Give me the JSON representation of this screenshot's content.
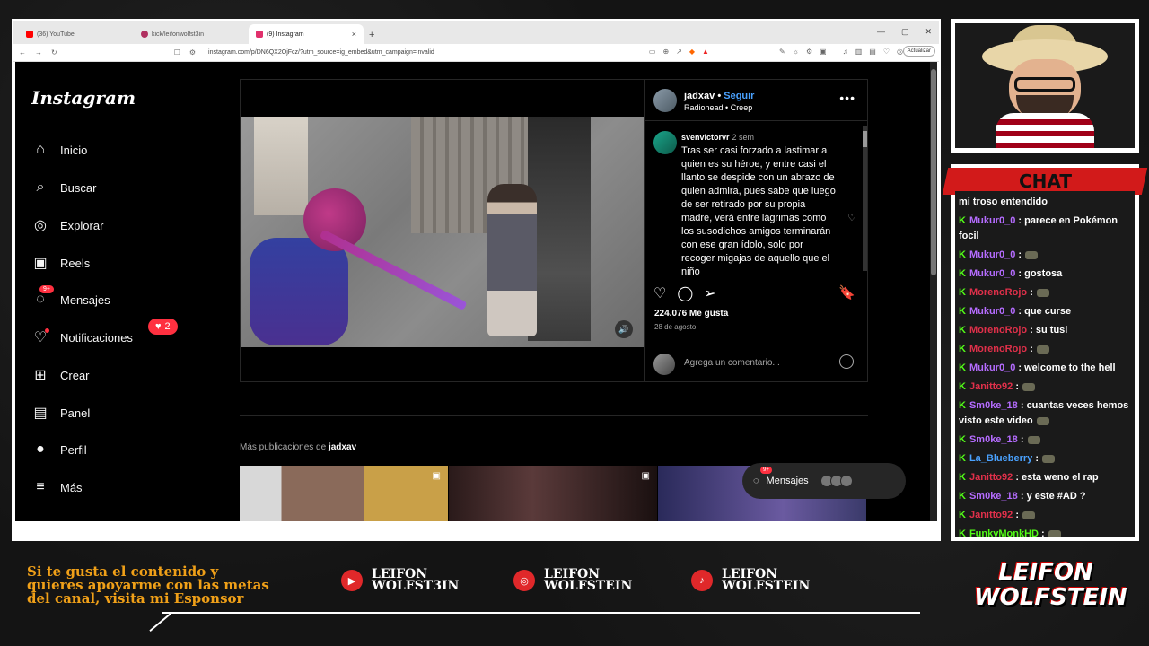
{
  "browser": {
    "tabs": [
      {
        "label": "(36) YouTube",
        "color": "#ff0000"
      },
      {
        "label": "kick/leifonwolfst3in",
        "color": "#b03060"
      },
      {
        "label": "(9) Instagram",
        "color": "#e1306c"
      }
    ],
    "new_tab": "+",
    "tab_close": "×",
    "url": "instagram.com/p/DN6QX2OjFcz/?utm_source=ig_embed&utm_campaign=invalid",
    "update_label": "Actualizar"
  },
  "instagram": {
    "logo": "Instagram",
    "nav": [
      {
        "label": "Inicio",
        "icon": "home-icon",
        "glyph": "⌂"
      },
      {
        "label": "Buscar",
        "icon": "search-icon",
        "glyph": "⌕"
      },
      {
        "label": "Explorar",
        "icon": "compass-icon",
        "glyph": "◎"
      },
      {
        "label": "Reels",
        "icon": "reels-icon",
        "glyph": "▣"
      },
      {
        "label": "Mensajes",
        "icon": "messenger-icon",
        "glyph": "◌"
      },
      {
        "label": "Notificaciones",
        "icon": "heart-icon",
        "glyph": "♡"
      },
      {
        "label": "Crear",
        "icon": "plus-icon",
        "glyph": "⊞"
      },
      {
        "label": "Panel",
        "icon": "chart-icon",
        "glyph": "▤"
      },
      {
        "label": "Perfil",
        "icon": "avatar",
        "glyph": "●"
      },
      {
        "label": "Más",
        "icon": "menu-icon",
        "glyph": "≡"
      }
    ],
    "messages_badge": "9+",
    "notif_count": "2",
    "post": {
      "username": "jadxav",
      "follow": "Seguir",
      "separator": "•",
      "song": "Radiohead • Creep",
      "comment_user": "svenvictorvr",
      "comment_time": "2 sem",
      "comment_text": "Tras ser casi forzado a lastimar a quien es su héroe, y entre casi el llanto se despide con un abrazo de quien admira, pues sabe que luego de ser retirado por su propia madre, verá entre lágrimas como los susodichos amigos terminarán con ese gran ídolo, solo por recoger migajas de aquello que el niño",
      "likes": "224.076 Me gusta",
      "date": "28 de agosto",
      "add_comment_placeholder": "Agrega un comentario..."
    },
    "more_pubs_prefix": "Más publicaciones de",
    "more_pubs_user": "jadxav",
    "messages_bar": {
      "label": "Mensajes",
      "badge": "9+"
    }
  },
  "chat": {
    "title": "CHAT",
    "messages": [
      {
        "user": "",
        "text": "mi troso entendido",
        "color": "#ffffff",
        "kick": false
      },
      {
        "user": "Mukur0_0",
        "text": ": parece en Pokémon focil",
        "color": "#b56cff",
        "kick": true
      },
      {
        "user": "Mukur0_0",
        "text": ":",
        "color": "#b56cff",
        "kick": true,
        "emote": true
      },
      {
        "user": "Mukur0_0",
        "text": ": gostosa",
        "color": "#b56cff",
        "kick": true
      },
      {
        "user": "MorenoRojo",
        "text": ":",
        "color": "#e0304a",
        "kick": true,
        "emote": true
      },
      {
        "user": "Mukur0_0",
        "text": ": que curse",
        "color": "#b56cff",
        "kick": true
      },
      {
        "user": "MorenoRojo",
        "text": ": su tusi",
        "color": "#e0304a",
        "kick": true
      },
      {
        "user": "MorenoRojo",
        "text": ":",
        "color": "#e0304a",
        "kick": true,
        "emote": true
      },
      {
        "user": "Mukur0_0",
        "text": ": welcome to the hell",
        "color": "#b56cff",
        "kick": true
      },
      {
        "user": "Janitto92",
        "text": ":",
        "color": "#e0304a",
        "kick": true,
        "emote": true
      },
      {
        "user": "Sm0ke_18",
        "text": ": cuantas veces hemos visto este video",
        "color": "#b56cff",
        "kick": true,
        "emote": true
      },
      {
        "user": "Sm0ke_18",
        "text": ":",
        "color": "#b56cff",
        "kick": true,
        "emote": true
      },
      {
        "user": "La_Blueberry",
        "text": ":",
        "color": "#4aa2ff",
        "kick": true,
        "emote": true
      },
      {
        "user": "Janitto92",
        "text": ": esta weno el rap",
        "color": "#e0304a",
        "kick": true
      },
      {
        "user": "Sm0ke_18",
        "text": ": y este #AD ?",
        "color": "#b56cff",
        "kick": true
      },
      {
        "user": "Janitto92",
        "text": ":",
        "color": "#e0304a",
        "kick": true,
        "emote": true
      },
      {
        "user": "FunkyMonkHD",
        "text": ":",
        "color": "#53fc18",
        "kick": true,
        "emote": true
      }
    ]
  },
  "footer": {
    "sponsor_text": "Si te gusta el contenido y quieres apoyarme con las metas del canal, visita mi Esponsor",
    "socials": [
      {
        "icon": "youtube-icon",
        "glyph": "▶",
        "line1": "LEIFON",
        "line2": "WOLFST3IN"
      },
      {
        "icon": "instagram-icon",
        "glyph": "◎",
        "line1": "LEIFON",
        "line2": "WOLFSTEIN"
      },
      {
        "icon": "tiktok-icon",
        "glyph": "♪",
        "line1": "LEIFON",
        "line2": "WOLFSTEIN"
      }
    ],
    "brand_line1": "LEIFON",
    "brand_line2": "WOLFSTEIN"
  }
}
